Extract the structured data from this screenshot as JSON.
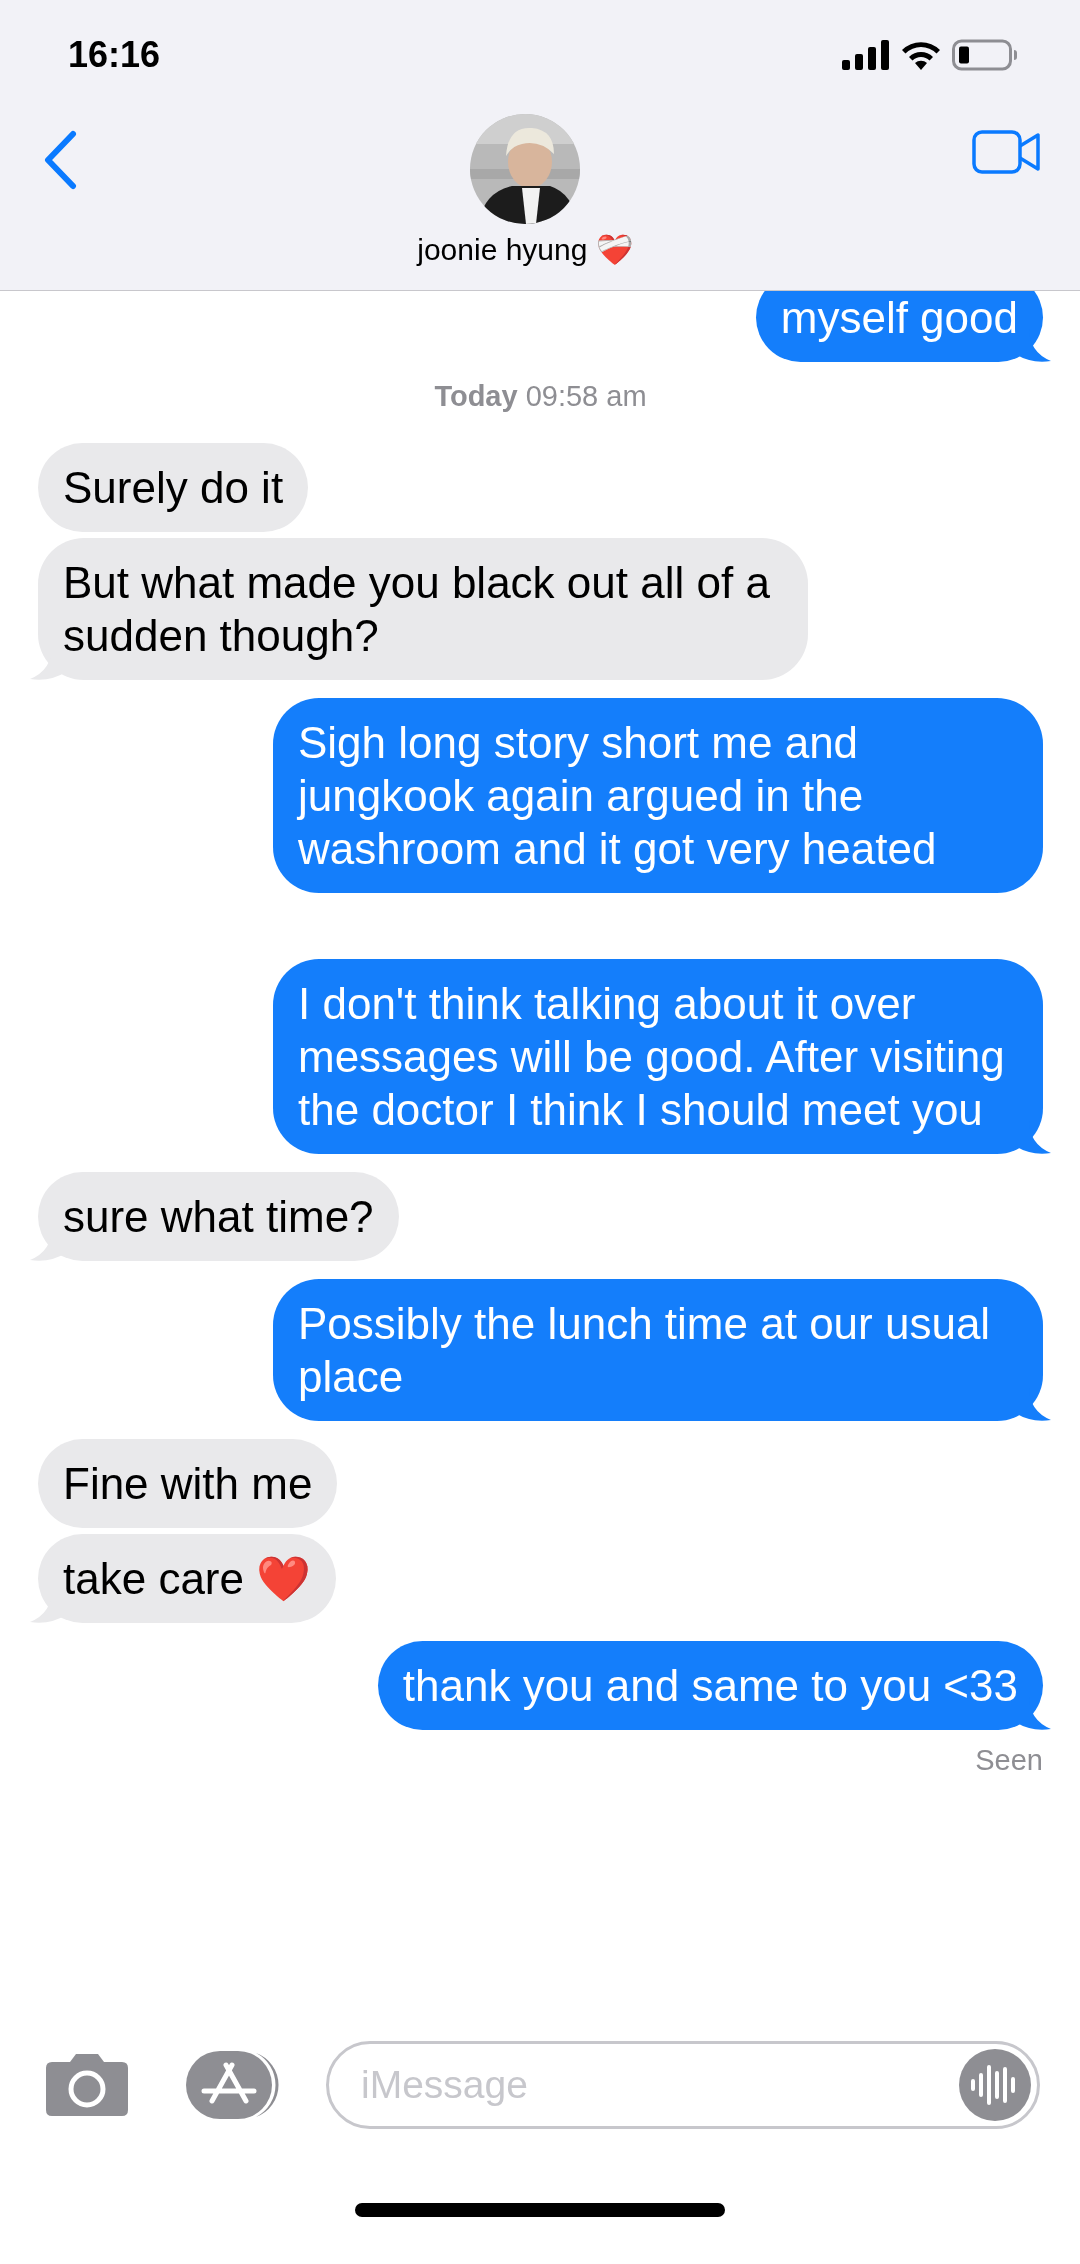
{
  "status_bar": {
    "time": "16:16"
  },
  "header": {
    "contact_name": "joonie hyung ❤️‍🩹"
  },
  "items": [
    {
      "kind": "message",
      "sent": true,
      "text": "myself good",
      "tail": true
    },
    {
      "kind": "timestamp",
      "text": "**Today** 09:58 am"
    },
    {
      "kind": "message",
      "sent": false,
      "text": "Surely do it",
      "tail": false
    },
    {
      "kind": "message",
      "sent": false,
      "text": "But what made you black out all of a sudden though?",
      "tail": true
    },
    {
      "kind": "message",
      "sent": true,
      "text": "Sigh long story short me and jungkook again argued in the washroom and it got very heated",
      "tail": false
    },
    {
      "kind": "message",
      "sent": true,
      "text": "I don't think talking about it over messages will be good. After visiting the doctor I think I should meet you",
      "tail": true
    },
    {
      "kind": "message",
      "sent": false,
      "text": "sure what time?",
      "tail": true
    },
    {
      "kind": "message",
      "sent": true,
      "text": "Possibly the lunch time at our usual place",
      "tail": true
    },
    {
      "kind": "message",
      "sent": false,
      "text": "Fine with me",
      "tail": false
    },
    {
      "kind": "message",
      "sent": false,
      "text": "take care ❤️",
      "tail": true
    },
    {
      "kind": "message",
      "sent": true,
      "text": "thank you and same to you <33",
      "tail": true
    },
    {
      "kind": "receipt",
      "text": "Seen"
    }
  ],
  "composer": {
    "placeholder": "iMessage"
  }
}
